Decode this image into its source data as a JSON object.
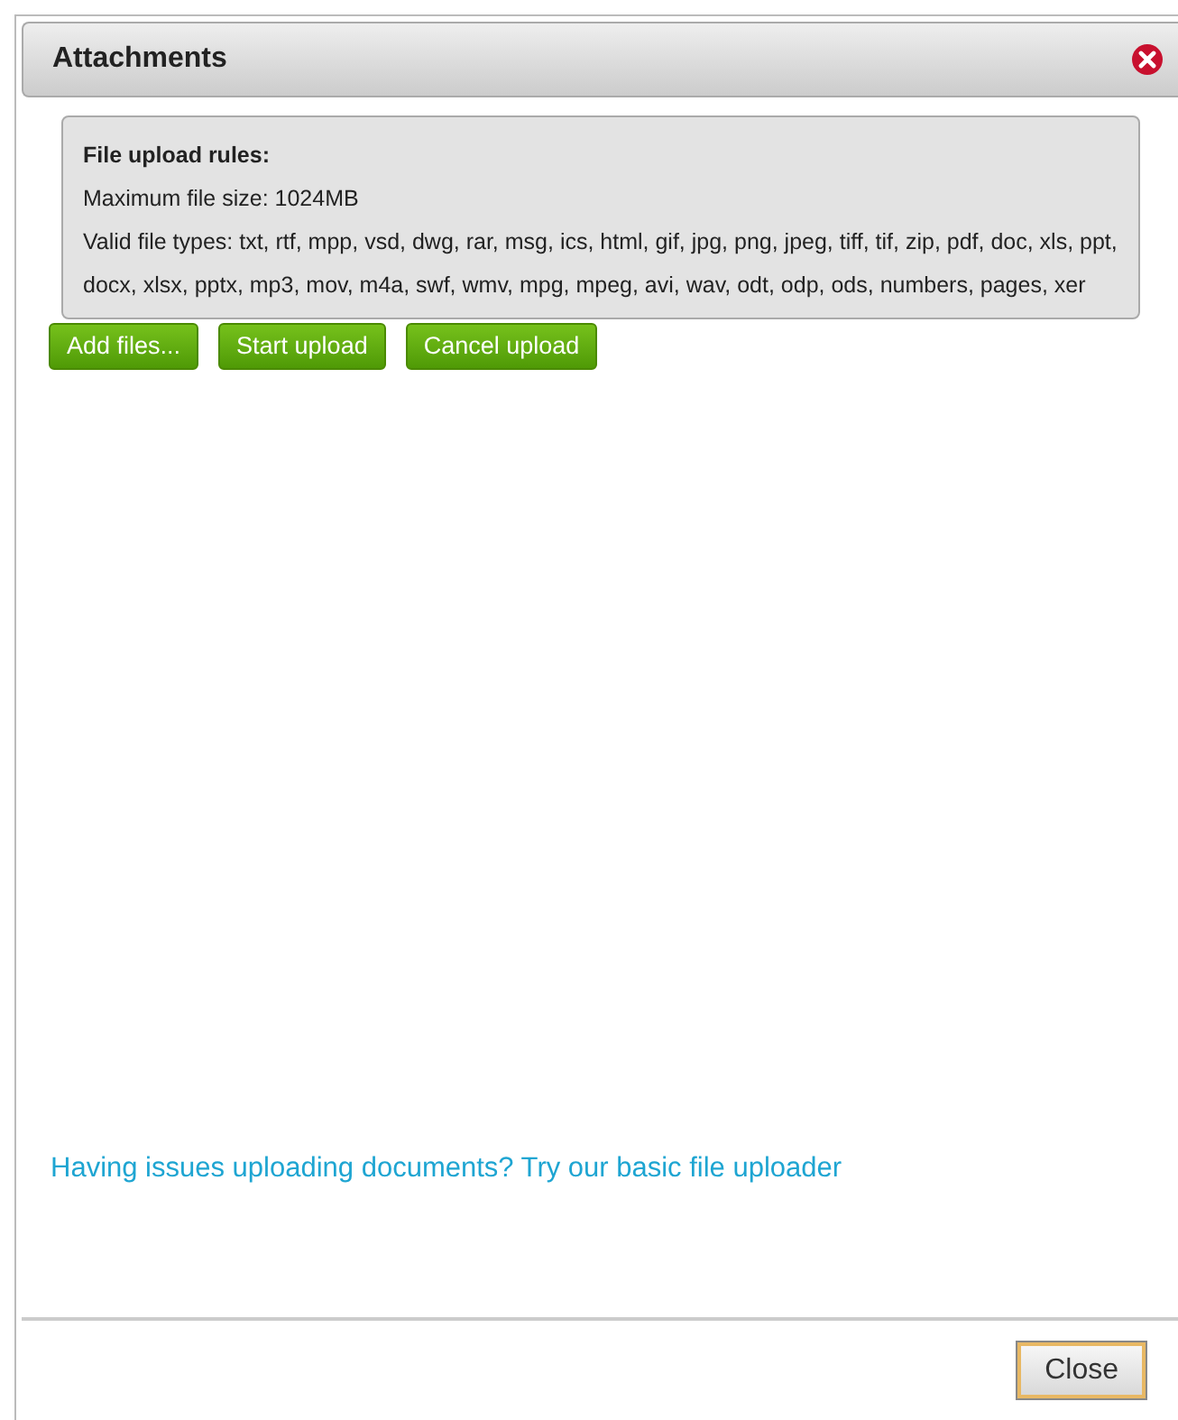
{
  "dialog": {
    "title": "Attachments"
  },
  "rules": {
    "heading": "File upload rules:",
    "items": [
      "Maximum file size: 1024MB",
      "Valid file types: txt, rtf, mpp, vsd, dwg, rar, msg, ics, html, gif, jpg, png, jpeg, tiff, tif, zip, pdf, doc, xls, ppt, docx, xlsx, pptx, mp3, mov, m4a, swf, wmv, mpg, mpeg, avi, wav, odt, odp, ods, numbers, pages, xer"
    ]
  },
  "buttons": [
    "Add files...",
    "Start upload",
    "Cancel upload"
  ],
  "link": "Having issues uploading documents? Try our basic file uploader",
  "footer_button": "Close"
}
